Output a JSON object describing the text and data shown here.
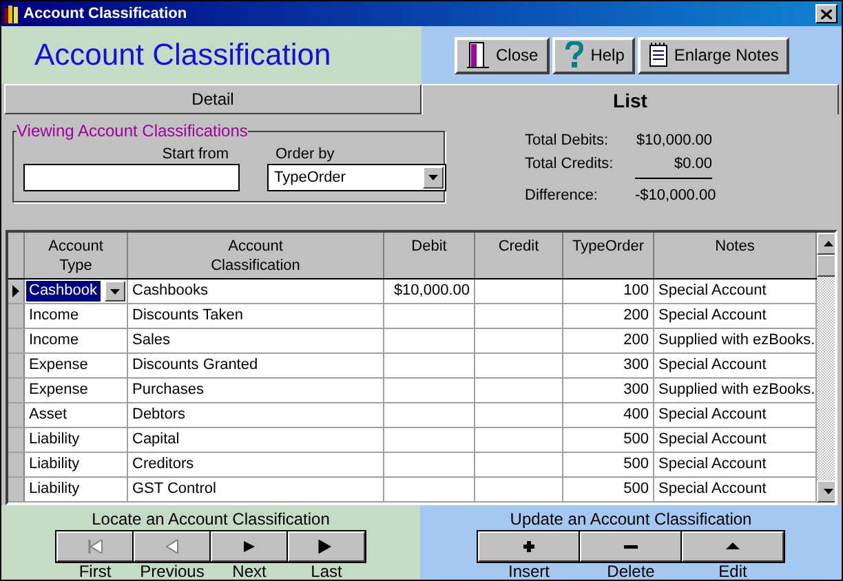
{
  "window": {
    "title": "Account Classification"
  },
  "header": {
    "title": "Account Classification",
    "buttons": [
      {
        "kind": "close",
        "label": "Close"
      },
      {
        "kind": "help",
        "label": "Help"
      },
      {
        "kind": "notes",
        "label": "Enlarge Notes"
      }
    ]
  },
  "tabs": [
    {
      "label": "Detail",
      "selected": false
    },
    {
      "label": "List",
      "selected": true
    }
  ],
  "filter": {
    "group_title": "Viewing Account Classifications",
    "start_label": "Start from",
    "order_label": "Order by",
    "order_value": "TypeOrder"
  },
  "totals": [
    {
      "label": "Total Debits:",
      "value": "$10,000.00"
    },
    {
      "label": "Total Credits:",
      "value": "$0.00"
    },
    {
      "label": "Difference:",
      "value": "-$10,000.00"
    }
  ],
  "table": {
    "columns": [
      "Account Type",
      "Account Classification",
      "Debit",
      "Credit",
      "TypeOrder",
      "Notes"
    ],
    "rows": [
      {
        "selected": true,
        "cells": [
          "Cashbook",
          "Cashbooks",
          "$10,000.00",
          "",
          "100",
          "Special Account"
        ]
      },
      {
        "selected": false,
        "cells": [
          "Income",
          "Discounts Taken",
          "",
          "",
          "200",
          "Special Account"
        ]
      },
      {
        "selected": false,
        "cells": [
          "Income",
          "Sales",
          "",
          "",
          "200",
          "Supplied with ezBooks."
        ]
      },
      {
        "selected": false,
        "cells": [
          "Expense",
          "Discounts Granted",
          "",
          "",
          "300",
          "Special Account"
        ]
      },
      {
        "selected": false,
        "cells": [
          "Expense",
          "Purchases",
          "",
          "",
          "300",
          "Supplied with ezBooks."
        ]
      },
      {
        "selected": false,
        "cells": [
          "Asset",
          "Debtors",
          "",
          "",
          "400",
          "Special Account"
        ]
      },
      {
        "selected": false,
        "cells": [
          "Liability",
          "Capital",
          "",
          "",
          "500",
          "Special Account"
        ]
      },
      {
        "selected": false,
        "cells": [
          "Liability",
          "Creditors",
          "",
          "",
          "500",
          "Special Account"
        ]
      },
      {
        "selected": false,
        "cells": [
          "Liability",
          "GST Control",
          "",
          "",
          "500",
          "Special Account"
        ]
      }
    ]
  },
  "locate": {
    "title": "Locate an Account Classification",
    "buttons": [
      {
        "kind": "first",
        "label": "First",
        "disabled": true
      },
      {
        "kind": "previous",
        "label": "Previous",
        "disabled": true
      },
      {
        "kind": "next",
        "label": "Next",
        "disabled": false
      },
      {
        "kind": "last",
        "label": "Last",
        "disabled": false
      }
    ]
  },
  "update": {
    "title": "Update an Account Classification",
    "buttons": [
      {
        "kind": "insert",
        "label": "Insert",
        "disabled": false
      },
      {
        "kind": "delete",
        "label": "Delete",
        "disabled": false
      },
      {
        "kind": "edit",
        "label": "Edit",
        "disabled": false
      }
    ]
  }
}
